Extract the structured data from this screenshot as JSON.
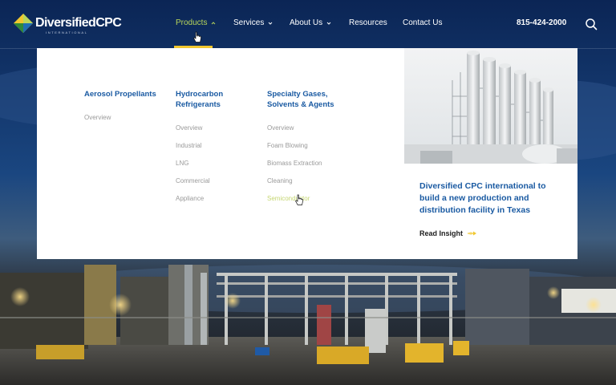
{
  "brand": {
    "name": "DiversifiedCPC",
    "sub": "INTERNATIONAL",
    "colors": {
      "navy": "#12376b",
      "accent_green": "#b9d65a",
      "accent_yellow": "#f1c72e",
      "link_blue": "#1a5aa2"
    }
  },
  "nav": {
    "items": [
      {
        "label": "Products",
        "active": true,
        "has_dropdown": true
      },
      {
        "label": "Services",
        "has_dropdown": true
      },
      {
        "label": "About Us",
        "has_dropdown": true
      },
      {
        "label": "Resources"
      },
      {
        "label": "Contact Us"
      }
    ],
    "phone": "815-424-2000",
    "search_icon": "search-icon"
  },
  "menu": {
    "columns": [
      {
        "title": "Aerosol Propellants",
        "links": [
          "Overview"
        ]
      },
      {
        "title": "Hydrocarbon Refrigerants",
        "links": [
          "Overview",
          "Industrial",
          "LNG",
          "Commercial",
          "Appliance"
        ]
      },
      {
        "title": "Specialty Gases, Solvents & Agents",
        "links": [
          "Overview",
          "Foam Blowing",
          "Biomass Extraction",
          "Cleaning",
          "Semiconductor"
        ]
      }
    ],
    "hovered_link": "Semiconductor",
    "feature": {
      "title": "Diversified CPC international to build a new production and distribution facility in Texas",
      "cta": "Read Insight"
    }
  }
}
